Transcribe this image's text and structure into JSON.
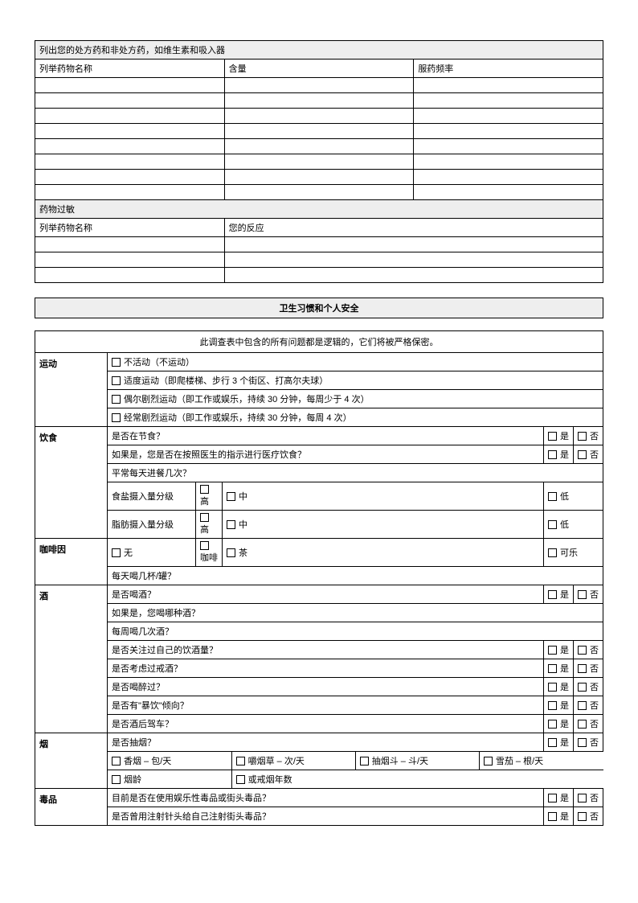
{
  "medications": {
    "title": "列出您的处方药和非处方药，如维生素和吸入器",
    "col_name": "列举药物名称",
    "col_dose": "含量",
    "col_freq": "服药频率"
  },
  "allergies": {
    "title": "药物过敏",
    "col_name": "列举药物名称",
    "col_reaction": "您的反应"
  },
  "section2_title": "卫生习惯和个人安全",
  "confidential": "此调查表中包含的所有问题都是逻辑的，它们将被严格保密。",
  "yes": "是",
  "no": "否",
  "exercise": {
    "label": "运动",
    "opt1": "不活动（不运动）",
    "opt2": "适度运动（即爬楼梯、步行 3 个街区、打高尔夫球）",
    "opt3": "偶尔剧烈运动（即工作或娱乐，持续 30 分钟，每周少于 4 次）",
    "opt4": "经常剧烈运动（即工作或娱乐，持续 30 分钟，每周 4 次）"
  },
  "diet": {
    "label": "饮食",
    "q1": "是否在节食？",
    "q2": "如果是，您是否在按照医生的指示进行医疗饮食？",
    "q3": "平常每天进餐几次？",
    "salt": "食盐摄入量分级",
    "fat": "脂肪摄入量分级",
    "high": "高",
    "mid": "中",
    "low": "低"
  },
  "caffeine": {
    "label": "咖啡因",
    "none": "无",
    "coffee": "咖啡",
    "tea": "茶",
    "cola": "可乐",
    "cups": "每天喝几杯/罐？"
  },
  "alcohol": {
    "label": "酒",
    "q1": "是否喝酒？",
    "q2": "如果是，您喝哪种酒？",
    "q3": "每周喝几次酒？",
    "q4": "是否关注过自己的饮酒量？",
    "q5": "是否考虑过戒酒？",
    "q6": "是否喝醉过？",
    "q7": "是否有\"暴饮\"倾向？",
    "q8": "是否酒后驾车？"
  },
  "tobacco": {
    "label": "烟",
    "q1": "是否抽烟？",
    "cig": "香烟 – 包/天",
    "chew": "嚼烟草 – 次/天",
    "pipe": "抽烟斗 – 斗/天",
    "cigar": "雪茄 – 根/天",
    "years": "烟龄",
    "quit": "或戒烟年数"
  },
  "drugs": {
    "label": "毒品",
    "q1": "目前是否在使用娱乐性毒品或街头毒品？",
    "q2": "是否曾用注射针头给自己注射街头毒品？"
  }
}
